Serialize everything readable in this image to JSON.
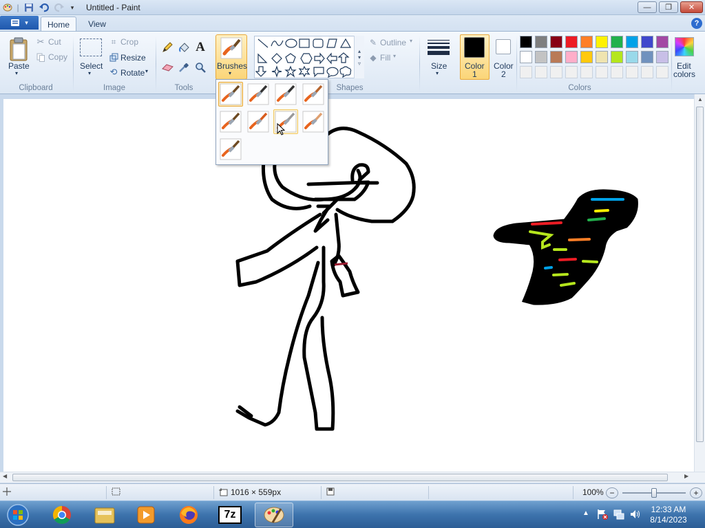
{
  "window": {
    "title": "Untitled - Paint",
    "buttons": {
      "minimize": "—",
      "maximize": "❐",
      "close": "✕"
    }
  },
  "tabs": [
    {
      "label": "Home",
      "active": true
    },
    {
      "label": "View",
      "active": false
    }
  ],
  "ribbon": {
    "clipboard": {
      "group": "Clipboard",
      "paste": "Paste",
      "cut": "Cut",
      "copy": "Copy"
    },
    "image": {
      "group": "Image",
      "select": "Select",
      "crop": "Crop",
      "resize": "Resize",
      "rotate": "Rotate"
    },
    "tools": {
      "group": "Tools"
    },
    "brushes": {
      "label": "Brushes"
    },
    "shapes": {
      "group": "Shapes",
      "outline": "Outline",
      "fill": "Fill"
    },
    "size": {
      "label": "Size"
    },
    "color1": {
      "label": "Color",
      "num": "1",
      "value": "#000000"
    },
    "color2": {
      "label": "Color",
      "num": "2",
      "value": "#ffffff"
    },
    "colors": {
      "group": "Colors",
      "edit": "Edit",
      "edit2": "colors"
    },
    "palette_row1": [
      "#000000",
      "#7f7f7f",
      "#880015",
      "#ed1c24",
      "#ff7f27",
      "#fff200",
      "#22b14c",
      "#00a2e8",
      "#3f48cc",
      "#a349a4"
    ],
    "palette_row2": [
      "#ffffff",
      "#c3c3c3",
      "#b97a57",
      "#ffaec9",
      "#ffc90e",
      "#efe4b0",
      "#b5e61d",
      "#99d9ea",
      "#7092be",
      "#c8bfe7"
    ],
    "palette_row3": [
      "#f0f0f0",
      "#f0f0f0",
      "#f0f0f0",
      "#f0f0f0",
      "#f0f0f0",
      "#f0f0f0",
      "#f0f0f0",
      "#f0f0f0",
      "#f0f0f0",
      "#f0f0f0"
    ]
  },
  "brushes_menu": {
    "items": [
      "brush-icon",
      "calligraphy-brush-1-icon",
      "calligraphy-brush-2-icon",
      "airbrush-icon",
      "oil-brush-icon",
      "crayon-icon",
      "marker-icon",
      "natural-pencil-icon",
      "watercolor-brush-icon"
    ],
    "selected_index": 0,
    "hover_index": 6
  },
  "status": {
    "dimensions": "1016 × 559px",
    "zoom": "100%",
    "zoom_level_fraction": 0.5
  },
  "clock": {
    "time": "12:33 AM",
    "date": "8/14/2023"
  },
  "taskbar": {
    "apps": [
      "start-orb-icon",
      "chrome-icon",
      "file-explorer-icon",
      "media-player-icon",
      "firefox-icon",
      "7zip-icon",
      "paint-icon"
    ],
    "sevenzip_label": "7z"
  }
}
